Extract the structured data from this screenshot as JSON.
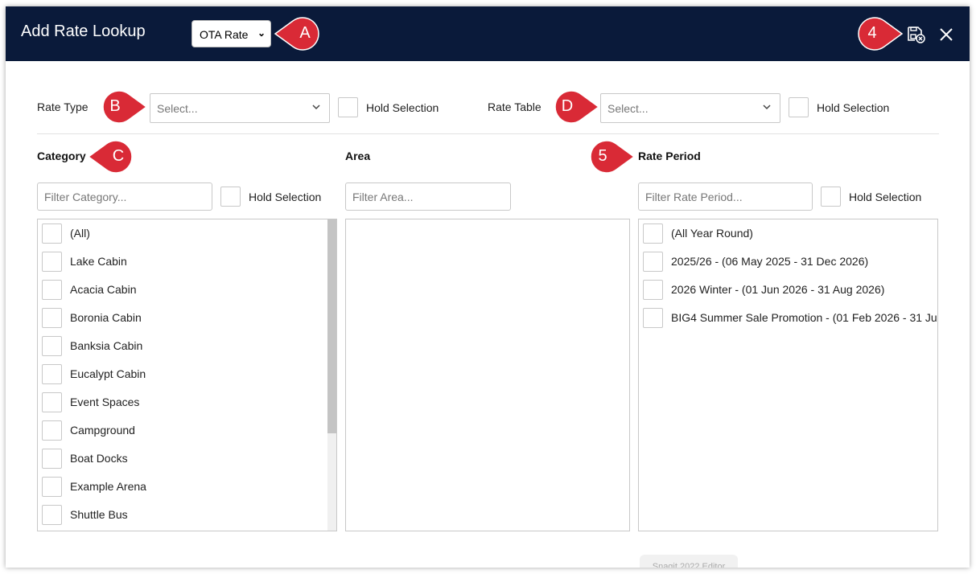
{
  "header": {
    "title": "Add Rate Lookup",
    "rate_select_value": "OTA Rate"
  },
  "callouts": {
    "a": "A",
    "b": "B",
    "c": "C",
    "d": "D",
    "four": "4",
    "five": "5"
  },
  "rate_type": {
    "label": "Rate Type",
    "placeholder": "Select...",
    "hold": "Hold Selection"
  },
  "rate_table": {
    "label": "Rate Table",
    "placeholder": "Select...",
    "hold": "Hold Selection"
  },
  "category": {
    "heading": "Category",
    "filter_placeholder": "Filter Category...",
    "hold": "Hold Selection",
    "items": [
      "(All)",
      "Lake Cabin",
      "Acacia Cabin",
      "Boronia Cabin",
      "Banksia Cabin",
      "Eucalypt Cabin",
      "Event Spaces",
      "Campground",
      "Boat Docks",
      "Example Arena",
      "Shuttle Bus"
    ]
  },
  "area": {
    "heading": "Area",
    "filter_placeholder": "Filter Area..."
  },
  "rate_period": {
    "heading": "Rate Period",
    "filter_placeholder": "Filter Rate Period...",
    "hold": "Hold Selection",
    "items": [
      "(All Year Round)",
      "2025/26 - (06 May 2025 - 31 Dec 2026)",
      "2026 Winter - (01 Jun 2026 - 31 Aug 2026)",
      "BIG4 Summer Sale Promotion - (01 Feb 2026 - 31 Ju"
    ]
  },
  "watermark": "Snagit 2022 Editor",
  "colors": {
    "header_bg": "#0a1a3a",
    "callout_red": "#d92a36"
  }
}
